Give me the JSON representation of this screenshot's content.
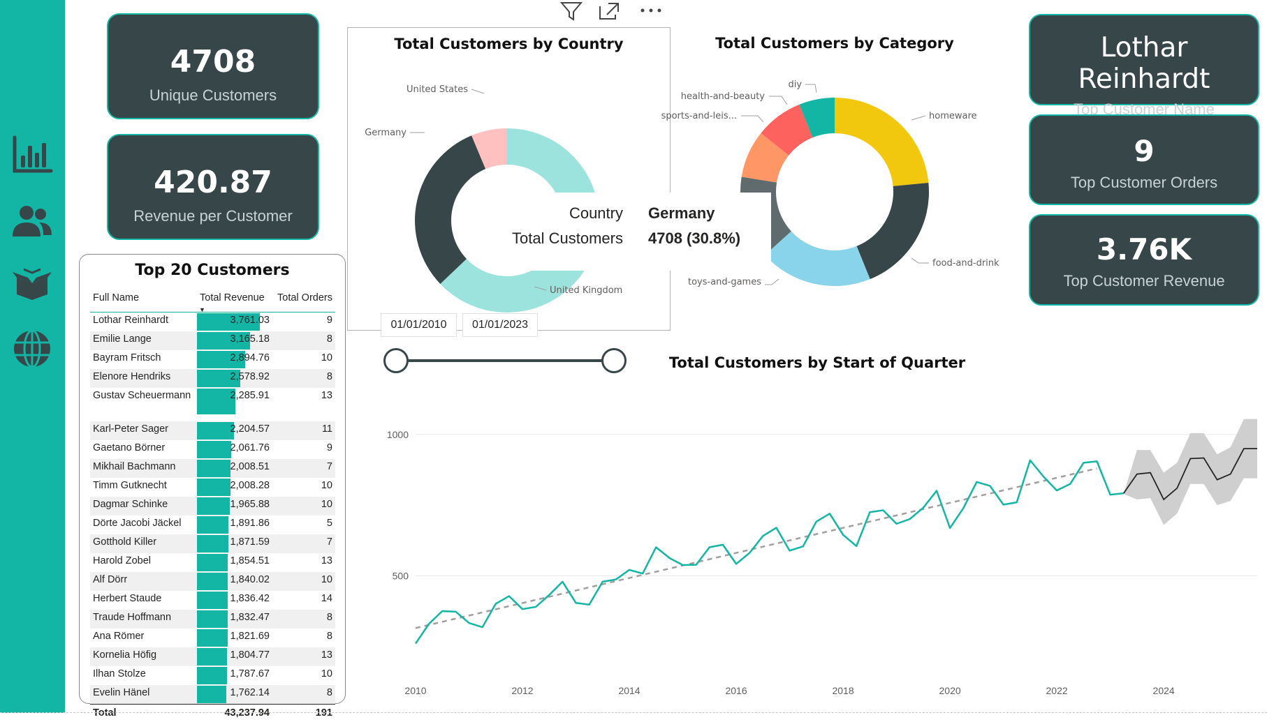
{
  "nav": {
    "items": [
      {
        "icon": "bar-chart-icon"
      },
      {
        "icon": "users-icon"
      },
      {
        "icon": "product-box-icon"
      },
      {
        "icon": "globe-icon"
      }
    ]
  },
  "kpis": {
    "unique_customers": {
      "value": "4708",
      "label": "Unique Customers"
    },
    "revenue_per_customer": {
      "value": "420.87",
      "label": "Revenue per Customer"
    },
    "top_customer_name": {
      "value": "Lothar Reinhardt",
      "label": "Top Customer Name"
    },
    "top_customer_orders": {
      "value": "9",
      "label": "Top Customer Orders"
    },
    "top_customer_revenue": {
      "value": "3.76K",
      "label": "Top Customer Revenue"
    }
  },
  "top_customers": {
    "title": "Top 20 Customers",
    "columns": [
      "Full Name",
      "Total Revenue",
      "Total Orders"
    ],
    "rows": [
      {
        "name": "Lothar Reinhardt",
        "revenue": "3,761.03",
        "revenue_value": 3761.03,
        "orders": "9"
      },
      {
        "name": "Emilie Lange",
        "revenue": "3,165.18",
        "revenue_value": 3165.18,
        "orders": "8"
      },
      {
        "name": "Bayram Fritsch",
        "revenue": "2,894.76",
        "revenue_value": 2894.76,
        "orders": "10"
      },
      {
        "name": "Elenore Hendriks",
        "revenue": "2,578.92",
        "revenue_value": 2578.92,
        "orders": "8"
      },
      {
        "name": "Gustav Scheuermann",
        "revenue": "2,285.91",
        "revenue_value": 2285.91,
        "orders": "13"
      },
      {
        "name": "Karl-Peter Sager",
        "revenue": "2,204.57",
        "revenue_value": 2204.57,
        "orders": "11"
      },
      {
        "name": "Gaetano Börner",
        "revenue": "2,061.76",
        "revenue_value": 2061.76,
        "orders": "9"
      },
      {
        "name": "Mikhail Bachmann",
        "revenue": "2,008.51",
        "revenue_value": 2008.51,
        "orders": "7"
      },
      {
        "name": "Timm Gutknecht",
        "revenue": "2,008.28",
        "revenue_value": 2008.28,
        "orders": "10"
      },
      {
        "name": "Dagmar Schinke",
        "revenue": "1,965.88",
        "revenue_value": 1965.88,
        "orders": "10"
      },
      {
        "name": "Dörte Jacobi Jäckel",
        "revenue": "1,891.86",
        "revenue_value": 1891.86,
        "orders": "5"
      },
      {
        "name": "Gotthold Killer",
        "revenue": "1,871.59",
        "revenue_value": 1871.59,
        "orders": "7"
      },
      {
        "name": "Harold Zobel",
        "revenue": "1,854.51",
        "revenue_value": 1854.51,
        "orders": "13"
      },
      {
        "name": "Alf Dörr",
        "revenue": "1,840.02",
        "revenue_value": 1840.02,
        "orders": "10"
      },
      {
        "name": "Herbert Staude",
        "revenue": "1,836.42",
        "revenue_value": 1836.42,
        "orders": "14"
      },
      {
        "name": "Traude Hoffmann",
        "revenue": "1,832.47",
        "revenue_value": 1832.47,
        "orders": "8"
      },
      {
        "name": "Ana Römer",
        "revenue": "1,821.69",
        "revenue_value": 1821.69,
        "orders": "8"
      },
      {
        "name": "Kornelia Höfig",
        "revenue": "1,804.77",
        "revenue_value": 1804.77,
        "orders": "13"
      },
      {
        "name": "Ilhan Stolze",
        "revenue": "1,787.67",
        "revenue_value": 1787.67,
        "orders": "10"
      },
      {
        "name": "Evelin Hänel",
        "revenue": "1,762.14",
        "revenue_value": 1762.14,
        "orders": "8"
      }
    ],
    "total": {
      "label": "Total",
      "revenue": "43,237.94",
      "orders": "191"
    }
  },
  "visual_header_icons": [
    "filter-icon",
    "focus-mode-icon",
    "more-options-icon"
  ],
  "tooltip": {
    "field1_label": "Country",
    "field1_value": "Germany",
    "field2_label": "Total Customers",
    "field2_value": "4708 (30.8%)"
  },
  "date_slicer": {
    "start": "01/01/2010",
    "end": "01/01/2023"
  },
  "colors": {
    "teal": "#13b5a5",
    "dark": "#374649",
    "card_bg": "#374649",
    "yellow": "#f2c80f",
    "light_blue": "#8ad4eb",
    "coral": "#fe9666",
    "red": "#fd625e",
    "pink": "#ffc0c0",
    "mint": "#9be3dc"
  },
  "chart_data": [
    {
      "type": "pie",
      "title": "Total Customers by Country",
      "categories": [
        "United Kingdom",
        "Germany",
        "United States"
      ],
      "values": [
        62.9,
        30.8,
        6.3
      ],
      "colors": [
        "#9be3dc",
        "#374649",
        "#ffc0c0"
      ],
      "legend": "none"
    },
    {
      "type": "pie",
      "title": "Total Customers by Category",
      "categories": [
        "homeware",
        "food-and-drink",
        "toys-and-games",
        "",
        "sports-and-leis...",
        "health-and-beauty",
        "diy"
      ],
      "values": [
        23,
        20,
        19,
        14,
        8,
        8,
        6
      ],
      "colors": [
        "#f2c80f",
        "#374649",
        "#8ad4eb",
        "#5f6b6d",
        "#fe9666",
        "#fd625e",
        "#13b5a5"
      ],
      "legend": "none"
    },
    {
      "type": "line",
      "title": "Total Customers by Start of Quarter",
      "xlabel": "",
      "ylabel": "",
      "x_ticks": [
        "2010",
        "2012",
        "2014",
        "2016",
        "2018",
        "2020",
        "2022",
        "2024"
      ],
      "y_ticks": [
        500,
        1000
      ],
      "ylim": [
        180,
        1180
      ],
      "xlim": [
        2010,
        2025.75
      ],
      "grid": true,
      "series": [
        {
          "x": [
            2010.0,
            2010.25,
            2010.5,
            2010.75,
            2011.0,
            2011.25,
            2011.5,
            2011.75,
            2012.0,
            2012.25,
            2012.5,
            2012.75,
            2013.0,
            2013.25,
            2013.5,
            2013.75,
            2014.0,
            2014.25,
            2014.5,
            2014.75,
            2015.0,
            2015.25,
            2015.5,
            2015.75,
            2016.0,
            2016.25,
            2016.5,
            2016.75,
            2017.0,
            2017.25,
            2017.5,
            2017.75,
            2018.0,
            2018.25,
            2018.5,
            2018.75,
            2019.0,
            2019.25,
            2019.5,
            2019.75,
            2020.0,
            2020.25,
            2020.5,
            2020.75,
            2021.0,
            2021.25,
            2021.5,
            2021.75,
            2022.0,
            2022.25,
            2022.5,
            2022.75,
            2023.0,
            2023.25
          ],
          "values": [
            260,
            330,
            375,
            373,
            333,
            318,
            401,
            428,
            382,
            390,
            432,
            479,
            404,
            398,
            479,
            487,
            521,
            508,
            601,
            563,
            538,
            539,
            601,
            610,
            542,
            581,
            641,
            670,
            589,
            604,
            692,
            720,
            645,
            605,
            725,
            732,
            684,
            701,
            741,
            801,
            669,
            739,
            832,
            818,
            752,
            760,
            909,
            851,
            802,
            825,
            900,
            905,
            787,
            792
          ]
        },
        {
          "x": [
            2023.25,
            2023.5,
            2023.75,
            2024.0,
            2024.25,
            2024.5,
            2024.75,
            2025.0,
            2025.25,
            2025.5,
            2025.75
          ],
          "values": [
            792,
            860,
            865,
            770,
            810,
            915,
            917,
            840,
            860,
            950,
            950
          ],
          "forecast": true,
          "upper": [
            790,
            945,
            945,
            865,
            900,
            1005,
            1005,
            930,
            955,
            1055,
            1055
          ],
          "lower": [
            790,
            770,
            775,
            680,
            720,
            825,
            825,
            750,
            765,
            845,
            845
          ]
        },
        {
          "trend": true,
          "x": [
            2010.0,
            2022.75
          ],
          "values": [
            315,
            880
          ]
        }
      ]
    }
  ]
}
